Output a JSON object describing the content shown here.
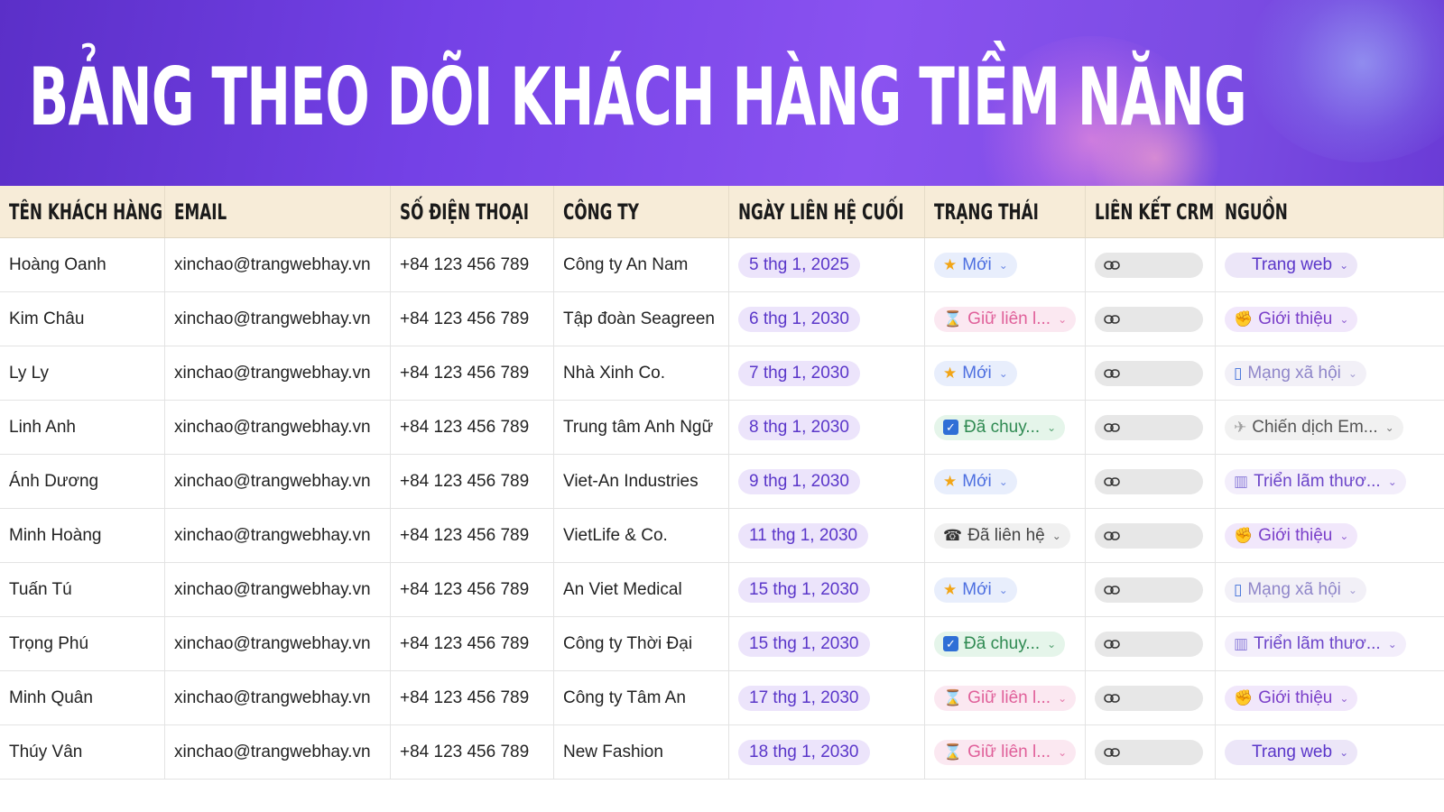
{
  "title": "BẢNG THEO DÕI KHÁCH HÀNG TIỀM NĂNG",
  "columns": [
    "TÊN KHÁCH HÀNG",
    "EMAIL",
    "SỐ ĐIỆN THOẠI",
    "CÔNG TY",
    "NGÀY LIÊN HỆ CUỐI",
    "TRẠNG THÁI",
    "LIÊN KẾT CRM",
    "NGUỒN"
  ],
  "rows": [
    {
      "name": "Hoàng Oanh",
      "email": "xinchao@trangwebhay.vn",
      "phone": "+84 123 456 789",
      "company": "Công ty An Nam",
      "date": "5 thg 1, 2025",
      "status": "Mới",
      "status_type": "new",
      "source": "Trang web",
      "source_type": "web"
    },
    {
      "name": "Kim Châu",
      "email": "xinchao@trangwebhay.vn",
      "phone": "+84 123 456 789",
      "company": "Tập đoàn Seagreen",
      "date": "6 thg 1, 2030",
      "status": "Giữ liên l...",
      "status_type": "keep",
      "source": "Giới thiệu",
      "source_type": "referral"
    },
    {
      "name": "Ly Ly",
      "email": "xinchao@trangwebhay.vn",
      "phone": "+84 123 456 789",
      "company": "Nhà Xinh Co.",
      "date": "7 thg 1, 2030",
      "status": "Mới",
      "status_type": "new",
      "source": "Mạng xã hội",
      "source_type": "social"
    },
    {
      "name": "Linh Anh",
      "email": "xinchao@trangwebhay.vn",
      "phone": "+84 123 456 789",
      "company": "Trung tâm Anh Ngữ",
      "date": "8 thg 1, 2030",
      "status": "Đã chuy...",
      "status_type": "converted",
      "source": "Chiến dịch Em...",
      "source_type": "campaign"
    },
    {
      "name": "Ánh Dương",
      "email": "xinchao@trangwebhay.vn",
      "phone": "+84 123 456 789",
      "company": "Viet-An Industries",
      "date": "9 thg 1, 2030",
      "status": "Mới",
      "status_type": "new",
      "source": "Triển lãm thươ...",
      "source_type": "expo"
    },
    {
      "name": "Minh Hoàng",
      "email": "xinchao@trangwebhay.vn",
      "phone": "+84 123 456 789",
      "company": "VietLife & Co.",
      "date": "11 thg 1, 2030",
      "status": "Đã liên hệ",
      "status_type": "contacted",
      "source": "Giới thiệu",
      "source_type": "referral"
    },
    {
      "name": "Tuấn Tú",
      "email": "xinchao@trangwebhay.vn",
      "phone": "+84 123 456 789",
      "company": "An Viet Medical",
      "date": "15 thg 1, 2030",
      "status": "Mới",
      "status_type": "new",
      "source": "Mạng xã hội",
      "source_type": "social"
    },
    {
      "name": "Trọng Phú",
      "email": "xinchao@trangwebhay.vn",
      "phone": "+84 123 456 789",
      "company": "Công ty Thời Đại",
      "date": "15 thg 1, 2030",
      "status": "Đã chuy...",
      "status_type": "converted",
      "source": "Triển lãm thươ...",
      "source_type": "expo"
    },
    {
      "name": "Minh Quân",
      "email": "xinchao@trangwebhay.vn",
      "phone": "+84 123 456 789",
      "company": "Công ty Tâm An",
      "date": "17 thg 1, 2030",
      "status": "Giữ liên l...",
      "status_type": "keep",
      "source": "Giới thiệu",
      "source_type": "referral"
    },
    {
      "name": "Thúy Vân",
      "email": "xinchao@trangwebhay.vn",
      "phone": "+84 123 456 789",
      "company": "New Fashion",
      "date": "18 thg 1, 2030",
      "status": "Giữ liên l...",
      "status_type": "keep",
      "source": "Trang web",
      "source_type": "web"
    }
  ],
  "icons": {
    "new": "star-icon",
    "keep": "hourglass-icon",
    "converted": "checkbox-icon",
    "contacted": "phone-icon",
    "referral": "handshake-icon",
    "social": "mobile-phone-icon",
    "campaign": "paper-plane-icon",
    "expo": "building-icon",
    "crm": "link-icon",
    "dropdown": "chevron-down-icon"
  }
}
